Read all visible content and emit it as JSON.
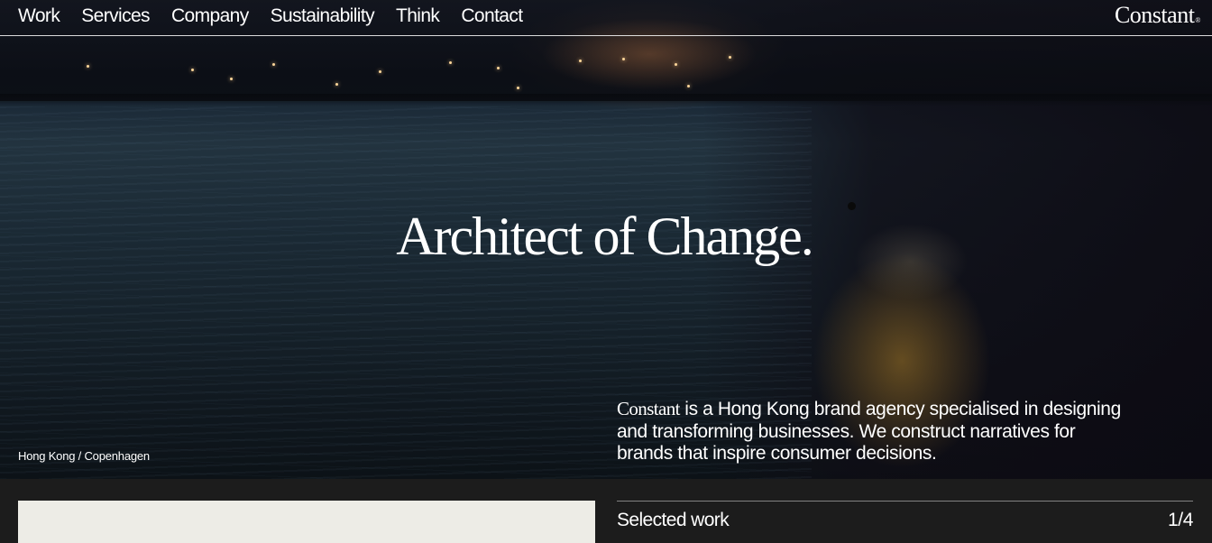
{
  "nav": {
    "items": [
      {
        "label": "Work"
      },
      {
        "label": "Services"
      },
      {
        "label": "Company"
      },
      {
        "label": "Sustainability"
      },
      {
        "label": "Think"
      },
      {
        "label": "Contact"
      }
    ]
  },
  "logo": {
    "text": "Constant",
    "mark": "®"
  },
  "hero": {
    "headline": "Architect of Change.",
    "location": "Hong Kong / Copenhagen",
    "intro_brand": "Constant",
    "intro_text": " is a Hong Kong brand agency specialised in designing and transforming businesses. We construct narratives for brands that inspire consumer decisions."
  },
  "selected_work": {
    "title": "Selected work",
    "counter": "1/4"
  },
  "colors": {
    "page_background": "#1c1c1c",
    "text": "#ffffff",
    "card_background": "#edece6"
  }
}
